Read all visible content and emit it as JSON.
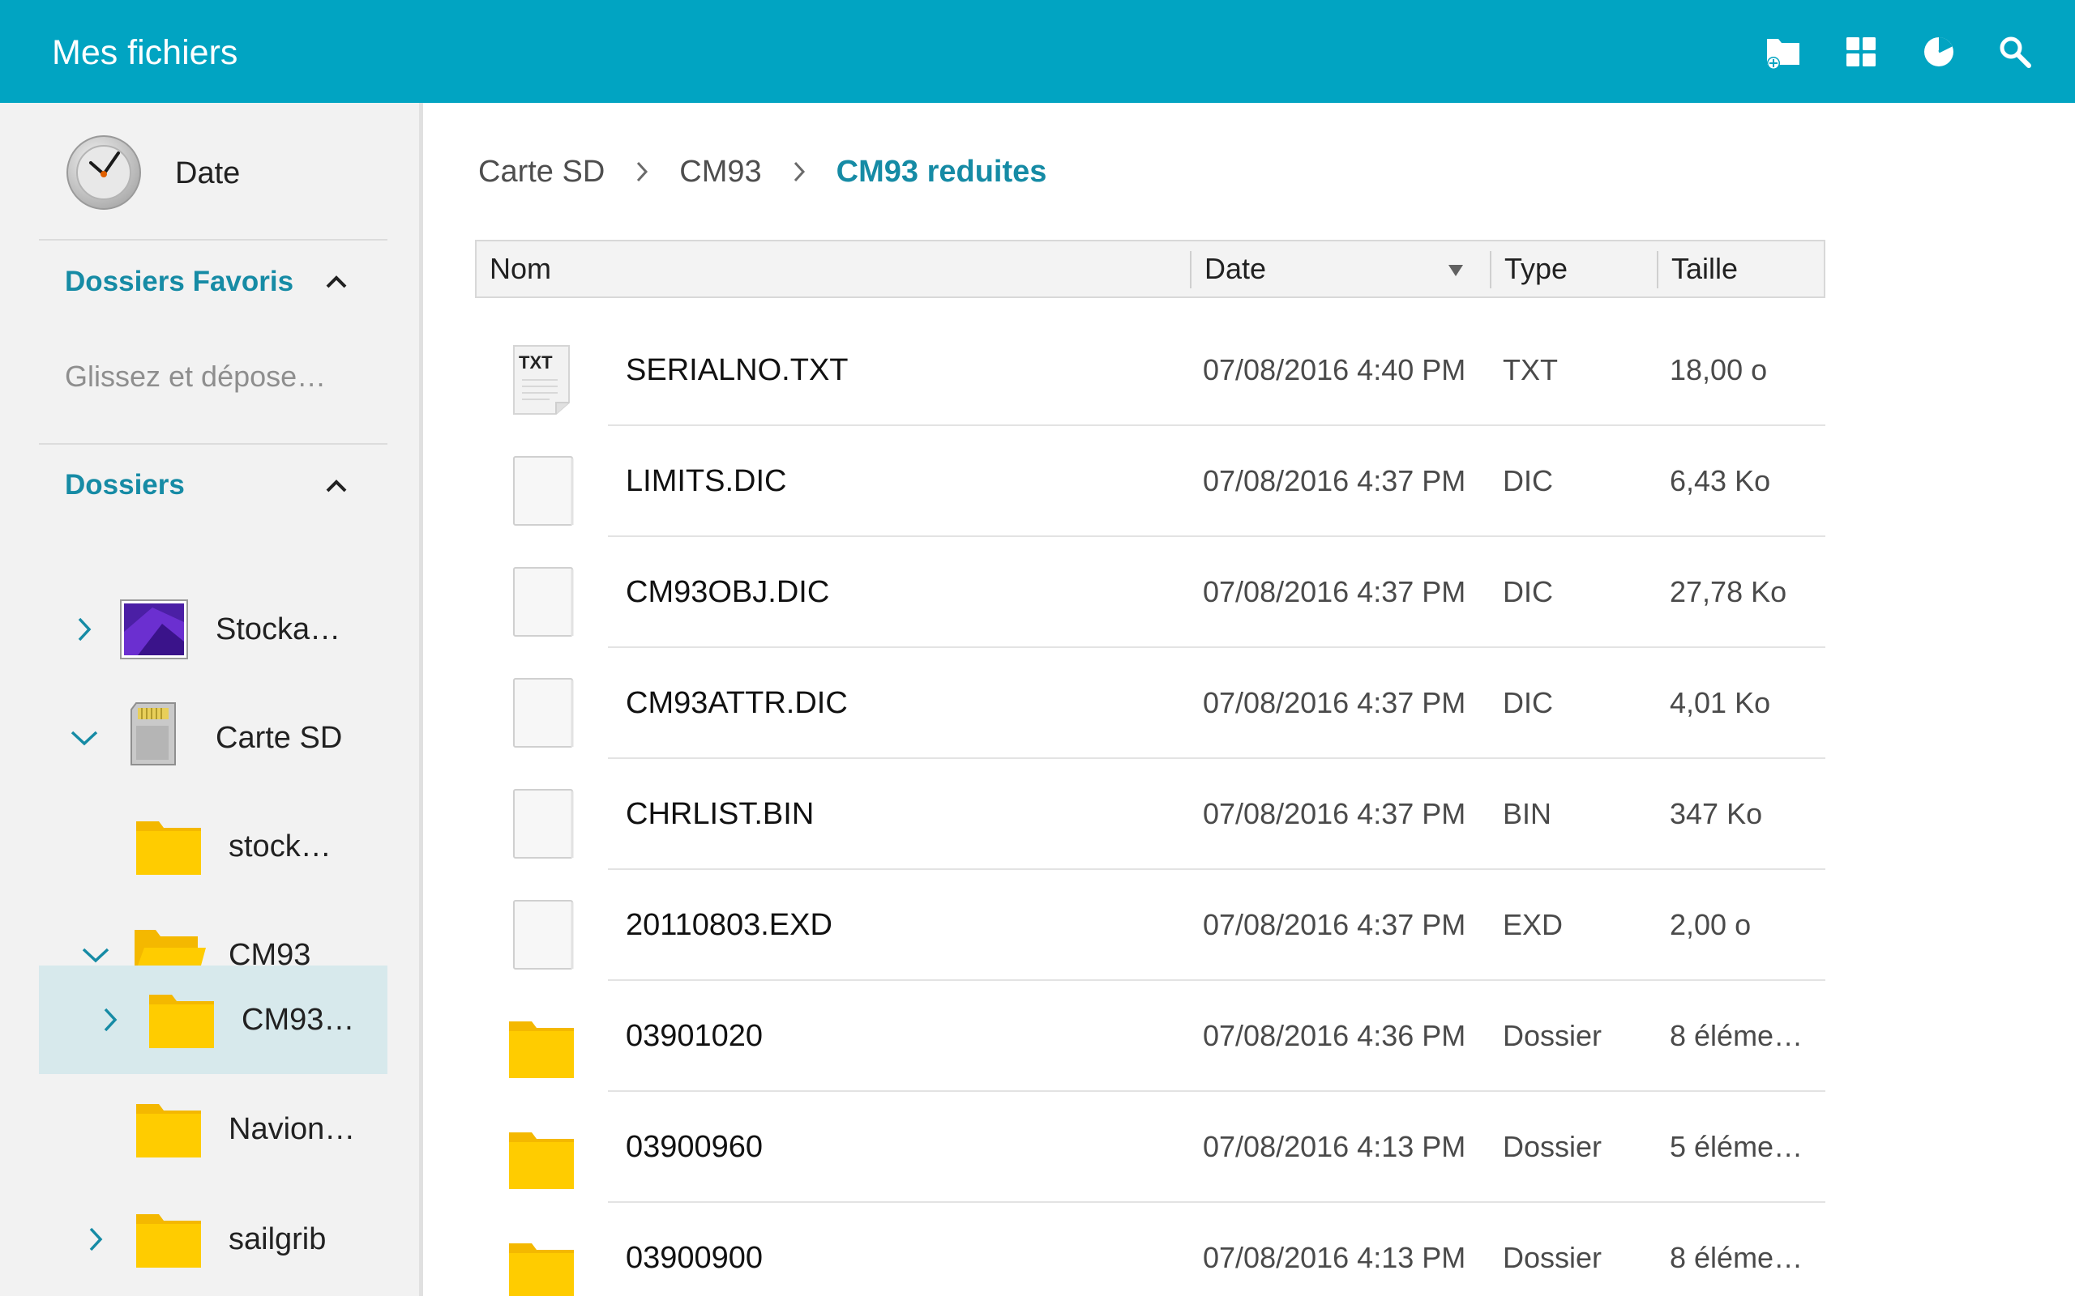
{
  "app": {
    "title": "Mes fichiers"
  },
  "toolbar": {
    "actions": [
      {
        "icon": "new-folder-icon"
      },
      {
        "icon": "grid-view-icon"
      },
      {
        "icon": "storage-pie-icon"
      },
      {
        "icon": "search-icon"
      }
    ]
  },
  "sidebar": {
    "date_label": "Date",
    "favorites": {
      "title": "Dossiers Favoris",
      "placeholder": "Glissez et dépose…"
    },
    "folders": {
      "title": "Dossiers",
      "items": [
        {
          "label": "Stocka…",
          "icon": "device-storage-icon",
          "toggle": "chevron-right"
        },
        {
          "label": "Carte SD",
          "icon": "sd-card-icon",
          "toggle": "chevron-down"
        },
        {
          "label": "stock…",
          "icon": "folder-icon",
          "toggle": ""
        },
        {
          "label": "CM93",
          "icon": "folder-open-icon",
          "toggle": "chevron-down"
        },
        {
          "label": "CM93…",
          "icon": "folder-icon",
          "toggle": "chevron-right",
          "selected": true
        },
        {
          "label": "Navion…",
          "icon": "folder-icon",
          "toggle": ""
        },
        {
          "label": "sailgrib",
          "icon": "folder-icon",
          "toggle": "chevron-right"
        }
      ]
    }
  },
  "breadcrumb": [
    "Carte SD",
    "CM93",
    "CM93 reduites"
  ],
  "table": {
    "columns": {
      "name": "Nom",
      "date": "Date",
      "type": "Type",
      "size": "Taille"
    },
    "sort_column": "date",
    "rows": [
      {
        "name": "SERIALNO.TXT",
        "date": "07/08/2016 4:40 PM",
        "type": "TXT",
        "size": "18,00 o",
        "icon": "txt-file-icon",
        "badge": "TXT"
      },
      {
        "name": "LIMITS.DIC",
        "date": "07/08/2016 4:37 PM",
        "type": "DIC",
        "size": "6,43 Ko",
        "icon": "file-icon"
      },
      {
        "name": "CM93OBJ.DIC",
        "date": "07/08/2016 4:37 PM",
        "type": "DIC",
        "size": "27,78 Ko",
        "icon": "file-icon"
      },
      {
        "name": "CM93ATTR.DIC",
        "date": "07/08/2016 4:37 PM",
        "type": "DIC",
        "size": "4,01 Ko",
        "icon": "file-icon"
      },
      {
        "name": "CHRLIST.BIN",
        "date": "07/08/2016 4:37 PM",
        "type": "BIN",
        "size": "347 Ko",
        "icon": "file-icon"
      },
      {
        "name": "20110803.EXD",
        "date": "07/08/2016 4:37 PM",
        "type": "EXD",
        "size": "2,00 o",
        "icon": "file-icon"
      },
      {
        "name": "03901020",
        "date": "07/08/2016 4:36 PM",
        "type": "Dossier",
        "size": "8 éléme…",
        "icon": "folder-icon"
      },
      {
        "name": "03900960",
        "date": "07/08/2016 4:13 PM",
        "type": "Dossier",
        "size": "5 éléme…",
        "icon": "folder-icon"
      },
      {
        "name": "03900900",
        "date": "07/08/2016 4:13 PM",
        "type": "Dossier",
        "size": "8 éléme…",
        "icon": "folder-icon"
      }
    ]
  },
  "colors": {
    "appbar": "#01a4c2",
    "accent": "#168ba5",
    "folder": "#ffcc00",
    "selected_row": "#d7e9ec"
  }
}
